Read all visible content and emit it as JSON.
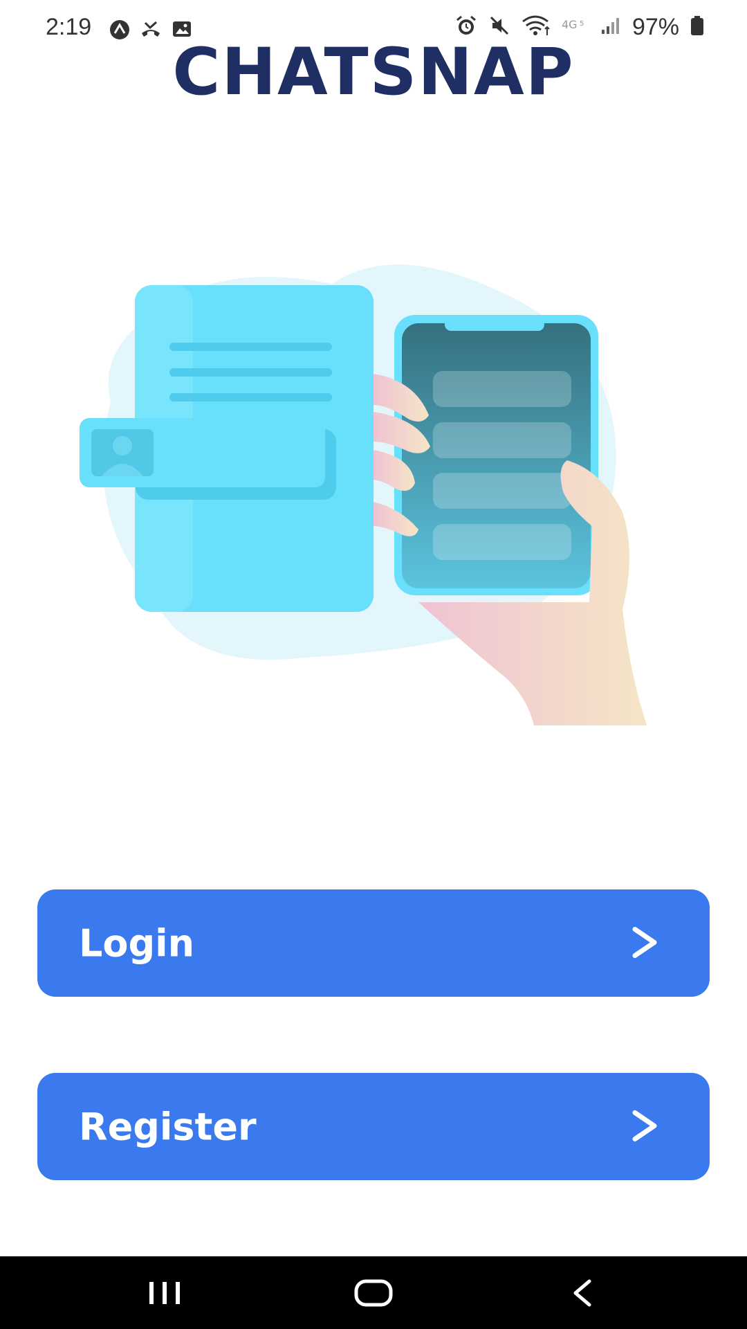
{
  "status_bar": {
    "time": "2:19",
    "battery": "97%",
    "icons_left": [
      "navigation-icon",
      "missed-call-icon",
      "image-icon"
    ],
    "icons_right": [
      "alarm-icon",
      "mute-icon",
      "wifi-icon",
      "4g-icon",
      "signal-icon",
      "battery-icon"
    ]
  },
  "header": {
    "title": "CHATSNAP"
  },
  "hero": {
    "icon": "phone-chat-illustration"
  },
  "actions": {
    "login_label": "Login",
    "register_label": "Register"
  },
  "nav": {
    "items": [
      "recents-button",
      "home-button",
      "back-button"
    ]
  },
  "colors": {
    "title": "#1f2e63",
    "button": "#3a7aee",
    "button_text": "#ffffff"
  }
}
